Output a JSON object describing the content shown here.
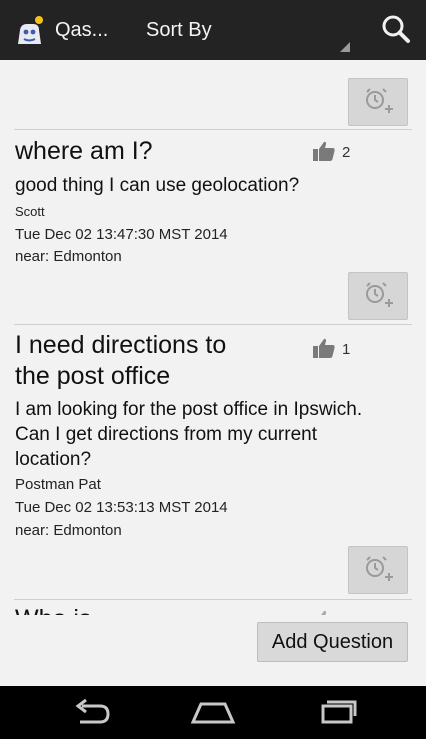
{
  "actionbar": {
    "title": "Qas...",
    "sort_label": "Sort By"
  },
  "icons": {
    "app": "app-logo-icon",
    "search": "search-icon",
    "alarm": "add-alarm-icon",
    "thumb": "thumbs-up-icon",
    "back": "back-icon",
    "home": "home-icon",
    "recents": "recent-apps-icon"
  },
  "questions": [
    {
      "title": "where am I?",
      "likes": "2",
      "body": "good thing I can use geolocation?",
      "author": "Scott",
      "date": "Tue Dec 02 13:47:30 MST 2014",
      "near": "near: Edmonton"
    },
    {
      "title": "I need directions to the post office",
      "likes": "1",
      "body": "I am looking for the post office in Ipswich. Can I get directions from my current location?",
      "author": "Postman Pat",
      "date": "Tue Dec 02 13:53:13 MST 2014",
      "near": "near: Edmonton"
    },
    {
      "title": "Who is"
    }
  ],
  "add_question_label": "Add Question",
  "colors": {
    "actionbar": "#232323",
    "background": "#f2f2f2",
    "button": "#d6d6d6"
  }
}
